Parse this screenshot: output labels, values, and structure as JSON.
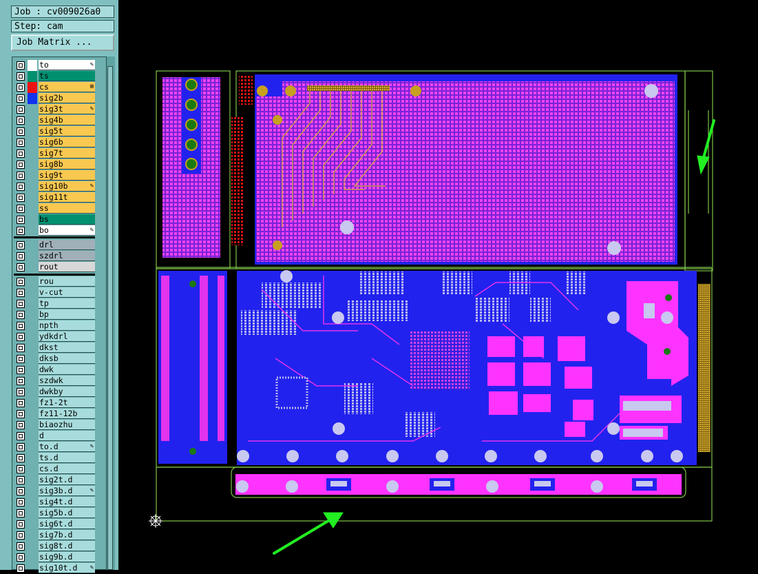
{
  "job_label": "Job : cv009026a0",
  "step_label": "Step: cam",
  "matrix_button": "Job Matrix ...",
  "layers_group1": [
    {
      "name": "to",
      "color": "#ffffff",
      "swatch": "#ffffff",
      "mark": "pen"
    },
    {
      "name": "ts",
      "color": "#009070",
      "swatch": "#009070",
      "mark": ""
    },
    {
      "name": "cs",
      "color": "#f8c850",
      "swatch": "#ee1111",
      "mark": "grid",
      "active": true
    },
    {
      "name": "sig2b",
      "color": "#f8c850",
      "swatch": "#1133ee",
      "mark": ""
    },
    {
      "name": "sig3t",
      "color": "#f8c850",
      "swatch": "",
      "mark": "pen"
    },
    {
      "name": "sig4b",
      "color": "#f8c850",
      "swatch": "",
      "mark": ""
    },
    {
      "name": "sig5t",
      "color": "#f8c850",
      "swatch": "",
      "mark": ""
    },
    {
      "name": "sig6b",
      "color": "#f8c850",
      "swatch": "",
      "mark": ""
    },
    {
      "name": "sig7t",
      "color": "#f8c850",
      "swatch": "",
      "mark": ""
    },
    {
      "name": "sig8b",
      "color": "#f8c850",
      "swatch": "",
      "mark": ""
    },
    {
      "name": "sig9t",
      "color": "#f8c850",
      "swatch": "",
      "mark": ""
    },
    {
      "name": "sig10b",
      "color": "#f8c850",
      "swatch": "",
      "mark": "pen"
    },
    {
      "name": "sig11t",
      "color": "#f8c850",
      "swatch": "",
      "mark": ""
    },
    {
      "name": "ss",
      "color": "#f8c850",
      "swatch": "",
      "mark": ""
    },
    {
      "name": "bs",
      "color": "#009070",
      "swatch": "",
      "mark": ""
    },
    {
      "name": "bo",
      "color": "#ffffff",
      "swatch": "",
      "mark": "pen"
    }
  ],
  "layers_group2": [
    {
      "name": "drl",
      "color": "#a0b0b8"
    },
    {
      "name": "szdrl",
      "color": "#a0b0b8"
    },
    {
      "name": "rout",
      "color": "#d8d8d8"
    }
  ],
  "layers_group3": [
    {
      "name": "rou",
      "mark": ""
    },
    {
      "name": "v-cut",
      "mark": ""
    },
    {
      "name": "tp",
      "mark": ""
    },
    {
      "name": "bp",
      "mark": ""
    },
    {
      "name": "npth",
      "mark": ""
    },
    {
      "name": "ydkdrl",
      "mark": ""
    },
    {
      "name": "dkst",
      "mark": ""
    },
    {
      "name": "dksb",
      "mark": ""
    },
    {
      "name": "dwk",
      "mark": ""
    },
    {
      "name": "szdwk",
      "mark": ""
    },
    {
      "name": "dwkby",
      "mark": ""
    },
    {
      "name": "fz1-2t",
      "mark": ""
    },
    {
      "name": "fz11-12b",
      "mark": ""
    },
    {
      "name": "biaozhu",
      "mark": ""
    },
    {
      "name": "d",
      "mark": ""
    },
    {
      "name": "to.d",
      "mark": "pen"
    },
    {
      "name": "ts.d",
      "mark": ""
    },
    {
      "name": "cs.d",
      "mark": ""
    },
    {
      "name": "sig2t.d",
      "mark": ""
    },
    {
      "name": "sig3b.d",
      "mark": "pen"
    },
    {
      "name": "sig4t.d",
      "mark": ""
    },
    {
      "name": "sig5b.d",
      "mark": ""
    },
    {
      "name": "sig6t.d",
      "mark": ""
    },
    {
      "name": "sig7b.d",
      "mark": ""
    },
    {
      "name": "sig8t.d",
      "mark": ""
    },
    {
      "name": "sig9b.d",
      "mark": ""
    },
    {
      "name": "sig10t.d",
      "mark": "pen"
    }
  ],
  "group3_color": "#a8dcdc",
  "colors": {
    "board_blue": "#2222ee",
    "board_magenta": "#e233ee",
    "pad_magenta": "#ff33ff",
    "outline_green": "#7fc44a",
    "arrow_green": "#22ee22",
    "pad_gold": "#c8a020",
    "hole_lavender": "#c8c8f0"
  },
  "annotations": [
    "green-arrow-right",
    "green-arrow-bottom"
  ]
}
